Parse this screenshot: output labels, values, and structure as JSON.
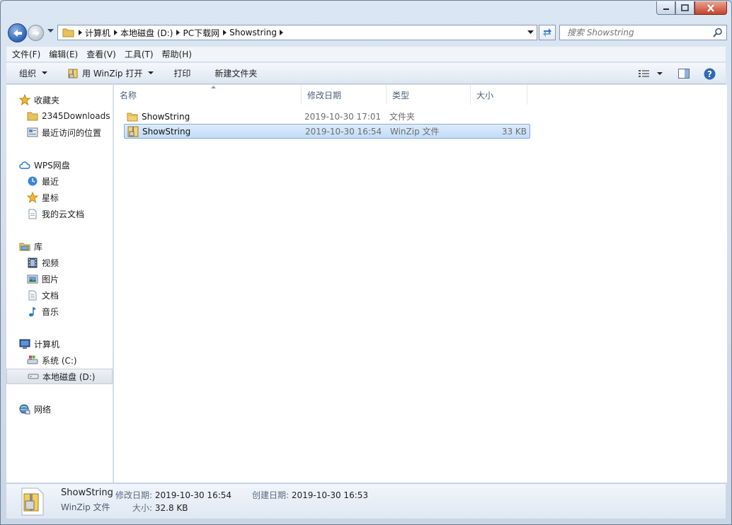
{
  "window": {
    "minimize": "—",
    "maximize": "□",
    "close": "✕"
  },
  "address": {
    "breadcrumbs": [
      "计算机",
      "本地磁盘 (D:)",
      "PC下载网",
      "Showstring"
    ]
  },
  "search": {
    "placeholder": "搜索 Showstring"
  },
  "menubar": {
    "items": [
      "文件(F)",
      "编辑(E)",
      "查看(V)",
      "工具(T)",
      "帮助(H)"
    ]
  },
  "toolbar": {
    "organize": "组织",
    "open_with": "用 WinZip 打开",
    "print": "打印",
    "new_folder": "新建文件夹"
  },
  "nav": {
    "favorites": "收藏夹",
    "downloads": "2345Downloads",
    "recent_places": "最近访问的位置",
    "wps": "WPS网盘",
    "wps_recent": "最近",
    "wps_starred": "星标",
    "wps_docs": "我的云文档",
    "libraries": "库",
    "videos": "视频",
    "pictures": "图片",
    "documents": "文档",
    "music": "音乐",
    "computer": "计算机",
    "drive_c": "系统 (C:)",
    "drive_d": "本地磁盘 (D:)",
    "network": "网络"
  },
  "columns": {
    "name": "名称",
    "date": "修改日期",
    "type": "类型",
    "size": "大小"
  },
  "files": [
    {
      "name": "ShowString",
      "date": "2019-10-30 17:01",
      "type": "文件夹",
      "size": ""
    },
    {
      "name": "ShowString",
      "date": "2019-10-30 16:54",
      "type": "WinZip 文件",
      "size": "33 KB"
    }
  ],
  "details": {
    "name": "ShowString",
    "type": "WinZip 文件",
    "modified_label": "修改日期:",
    "modified_value": "2019-10-30 16:54",
    "size_label": "大小:",
    "size_value": "32.8 KB",
    "created_label": "创建日期:",
    "created_value": "2019-10-30 16:53"
  },
  "colors": {
    "selection": "#cde3fb",
    "nav_selected": "#e3e7ee",
    "header_text": "#4c607a"
  }
}
